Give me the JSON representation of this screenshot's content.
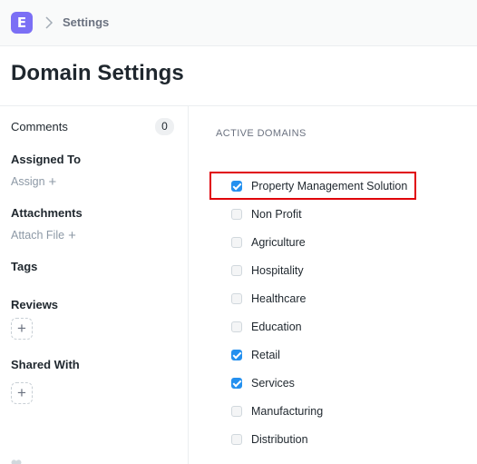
{
  "app": {
    "logo_letter": "E"
  },
  "breadcrumb": {
    "current": "Settings"
  },
  "page": {
    "title": "Domain Settings"
  },
  "sidebar": {
    "comments": {
      "label": "Comments",
      "count": "0"
    },
    "assigned_to": {
      "label": "Assigned To",
      "action": "Assign"
    },
    "attachments": {
      "label": "Attachments",
      "action": "Attach File"
    },
    "tags": {
      "label": "Tags"
    },
    "reviews": {
      "label": "Reviews",
      "add": "+"
    },
    "shared_with": {
      "label": "Shared With",
      "add": "+"
    }
  },
  "main": {
    "section_title": "ACTIVE DOMAINS",
    "domains": [
      {
        "label": "Property Management Solution",
        "checked": true
      },
      {
        "label": "Non Profit",
        "checked": false
      },
      {
        "label": "Agriculture",
        "checked": false
      },
      {
        "label": "Hospitality",
        "checked": false
      },
      {
        "label": "Healthcare",
        "checked": false
      },
      {
        "label": "Education",
        "checked": false
      },
      {
        "label": "Retail",
        "checked": true
      },
      {
        "label": "Services",
        "checked": true
      },
      {
        "label": "Manufacturing",
        "checked": false
      },
      {
        "label": "Distribution",
        "checked": false
      }
    ]
  },
  "colors": {
    "accent": "#2490ef",
    "logo": "#7b6ff5",
    "highlight": "#e0000a"
  }
}
